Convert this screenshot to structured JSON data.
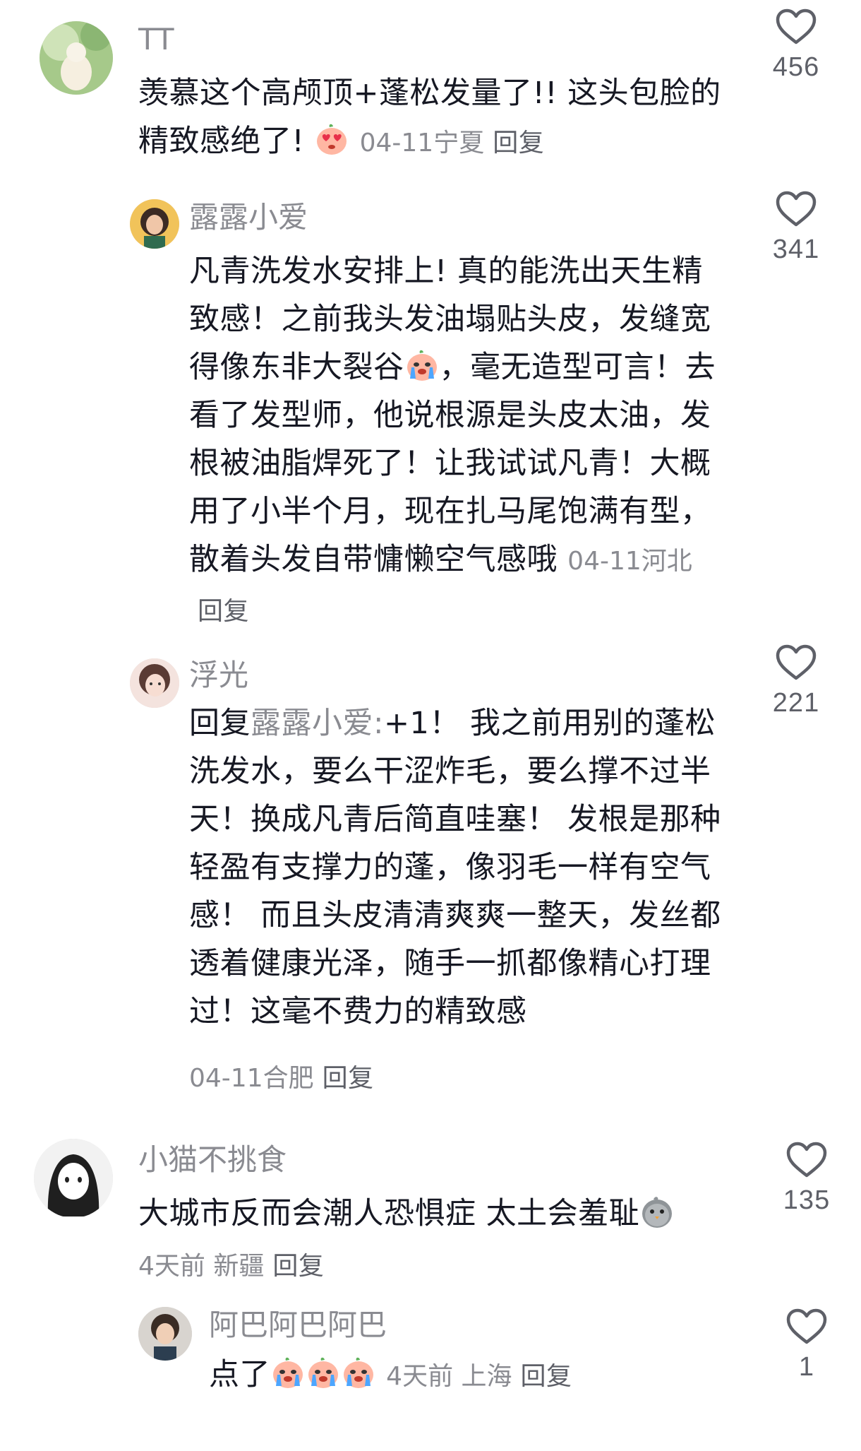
{
  "comments": [
    {
      "username": "TT",
      "text": "羡慕这个高颅顶+蓬松发量了!! 这头包脸的精致感绝了!",
      "emoji": "heart-eyes-peach",
      "meta": "04-11宁夏",
      "reply": "回复",
      "likes": "456"
    },
    {
      "username": "露露小爱",
      "text_a": "凡青洗发水安排上! 真的能洗出天生精致感！之前我头发油塌贴头皮，发缝宽得像东非大裂谷",
      "emoji": "crying-peach",
      "text_b": "，毫无造型可言！去看了发型师，他说根源是头皮太油，发根被油脂焊死了！让我试试凡青！大概用了小半个月，现在扎马尾饱满有型，散着头发自带慵懒空气感哦",
      "meta": "04-11河北",
      "reply": "回复",
      "likes": "341"
    },
    {
      "username": "浮光",
      "reply_prefix": "回复",
      "reply_to": "露露小爱:",
      "text": "+1！ 我之前用别的蓬松洗发水，要么干涩炸毛，要么撑不过半天！换成凡青后简直哇塞！ 发根是那种轻盈有支撑力的蓬，像羽毛一样有空气感！ 而且头皮清清爽爽一整天，发丝都透着健康光泽，随手一抓都像精心打理过！这毫不费力的精致感",
      "meta": "04-11合肥",
      "reply": "回复",
      "likes": "221"
    },
    {
      "username": "小猫不挑食",
      "text": "大城市反而会潮人恐惧症 太土会羞耻",
      "emoji": "sad-chick",
      "meta": "4天前 新疆",
      "reply": "回复",
      "likes": "135"
    },
    {
      "username": "阿巴阿巴阿巴",
      "text": "点了",
      "emoji": "crying-peach",
      "meta": "4天前 上海",
      "reply": "回复",
      "likes": "1"
    }
  ]
}
